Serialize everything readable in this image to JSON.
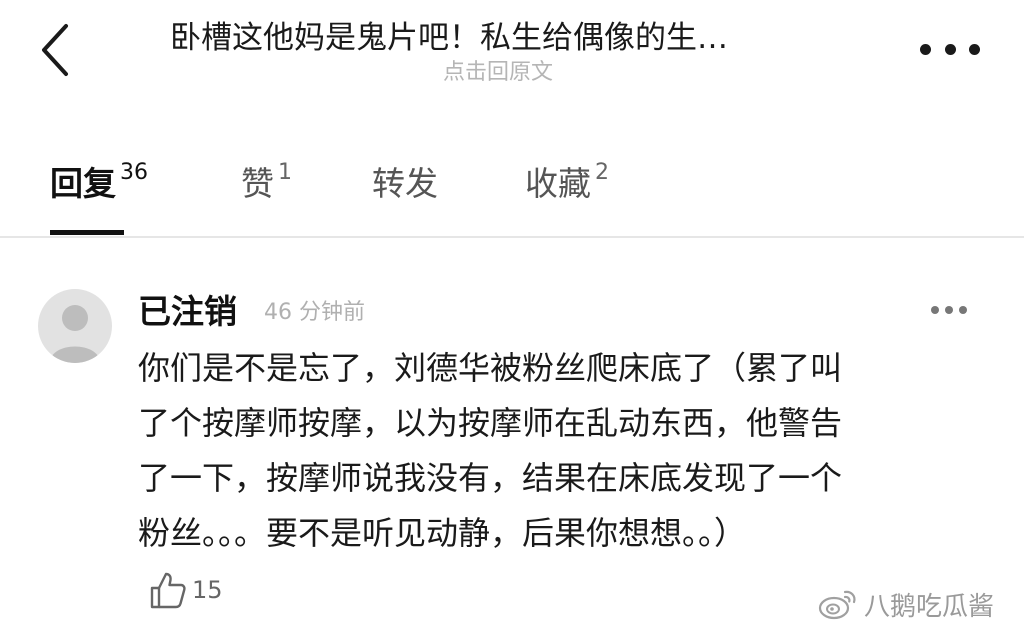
{
  "header": {
    "title": "卧槽这他妈是鬼片吧！私生给偶像的生…",
    "subtitle": "点击回原文",
    "back_icon": "chevron-left-icon",
    "more_icon": "more-horizontal-icon"
  },
  "tabs": [
    {
      "label": "回复",
      "count": "36",
      "active": true
    },
    {
      "label": "赞",
      "count": "1",
      "active": false
    },
    {
      "label": "转发",
      "count": "",
      "active": false
    },
    {
      "label": "收藏",
      "count": "2",
      "active": false
    }
  ],
  "comment": {
    "username": "已注销",
    "timestamp": "46 分钟前",
    "lines": [
      "你们是不是忘了，刘德华被粉丝爬床底了（累了叫",
      "了个按摩师按摩，以为按摩师在乱动东西，他警告",
      "了一下，按摩师说我没有，结果在床底发现了一个",
      "粉丝。。。要不是听见动静，后果你想想。。）"
    ],
    "like_count": "15",
    "like_icon": "thumbs-up-icon"
  },
  "watermark": {
    "text": "八鹅吃瓜酱",
    "icon": "weibo-logo-icon"
  },
  "colors": {
    "text": "#1a1a1a",
    "muted": "#b0b0b0",
    "divider": "#e6e6e6",
    "accent": "#111111"
  }
}
